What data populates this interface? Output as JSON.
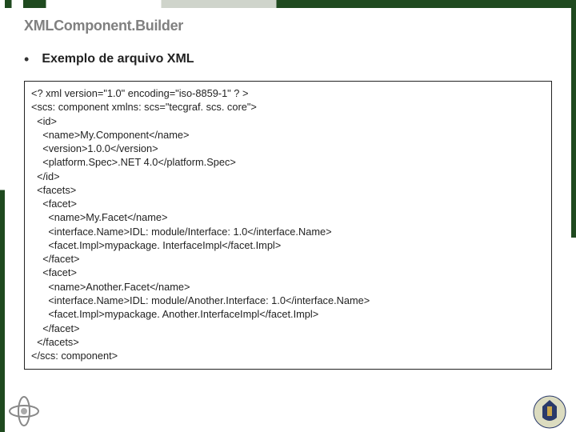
{
  "title": "XMLComponent.Builder",
  "subtitle": "Exemplo de arquivo XML",
  "code": "<? xml version=\"1.0\" encoding=\"iso-8859-1\" ? >\n<scs: component xmlns: scs=\"tecgraf. scs. core\">\n  <id>\n    <name>My.Component</name>\n    <version>1.0.0</version>\n    <platform.Spec>.NET 4.0</platform.Spec>\n  </id>\n  <facets>\n    <facet>\n      <name>My.Facet</name>\n      <interface.Name>IDL: module/Interface: 1.0</interface.Name>\n      <facet.Impl>mypackage. InterfaceImpl</facet.Impl>\n    </facet>\n    <facet>\n      <name>Another.Facet</name>\n      <interface.Name>IDL: module/Another.Interface: 1.0</interface.Name>\n      <facet.Impl>mypackage. Another.InterfaceImpl</facet.Impl>\n    </facet>\n  </facets>\n</scs: component>"
}
